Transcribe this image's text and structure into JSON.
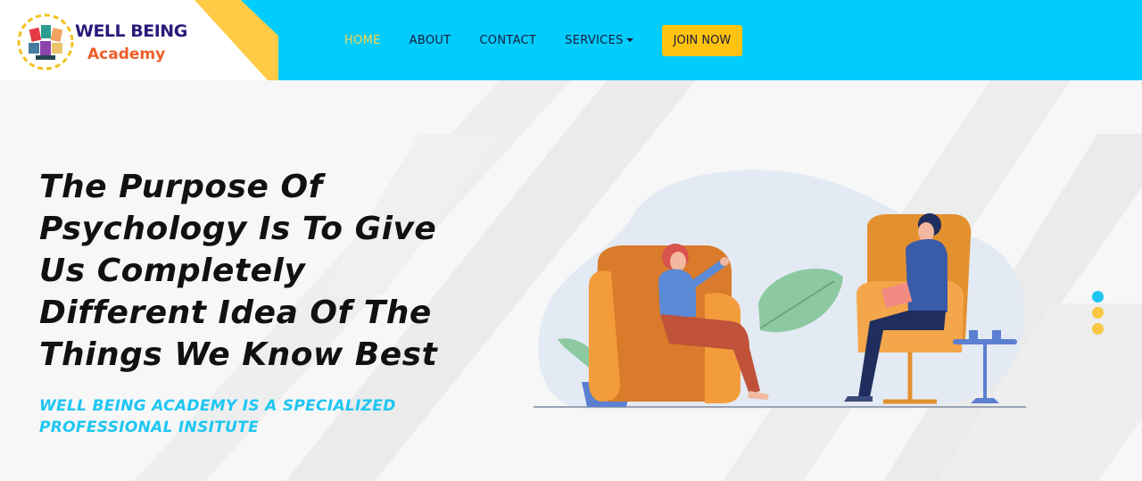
{
  "brand": {
    "title": "WELL BEING",
    "subtitle": "Academy"
  },
  "nav": {
    "items": [
      {
        "label": "HOME",
        "active": true
      },
      {
        "label": "ABOUT"
      },
      {
        "label": "CONTACT"
      },
      {
        "label": "SERVICES",
        "has_dropdown": true
      }
    ],
    "cta_label": "JOIN NOW"
  },
  "hero": {
    "headline": "The Purpose Of Psychology Is To Give Us Completely Different Idea Of The Things We Know Best",
    "subline": "WELL BEING ACADEMY IS A SPECIALIZED PROFESSIONAL INSITUTE"
  },
  "slider": {
    "dots": [
      {
        "color": "#1ec6f2",
        "active": true
      },
      {
        "color": "#f7c843"
      },
      {
        "color": "#f7c843"
      }
    ]
  },
  "colors": {
    "header_blue": "#00ccfd",
    "accent_yellow": "#ffc30f",
    "subline_cyan": "#1ec6f2"
  }
}
